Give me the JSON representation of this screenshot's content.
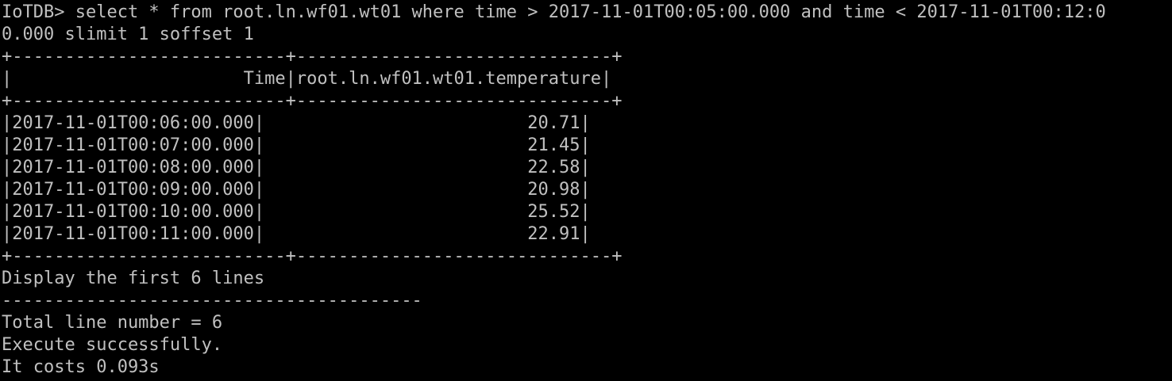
{
  "terminal": {
    "background": "#000000",
    "foreground": "#c0c0c0",
    "command_line_1": "IoTDB> select * from root.ln.wf01.wt01 where time > 2017-11-01T00:05:00.000 and time < 2017-11-01T00:12:0",
    "command_line_2": "0.000 slimit 1 soffset 1",
    "table": {
      "border_line": "+--------------------------+------------------------------+",
      "header": "|                      Time|root.ln.wf01.wt01.temperature|",
      "rows": [
        "|2017-11-01T00:06:00.000|                         20.71|",
        "|2017-11-01T00:07:00.000|                         21.45|",
        "|2017-11-01T00:08:00.000|                         22.58|",
        "|2017-11-01T00:09:00.000|                         20.98|",
        "|2017-11-01T00:10:00.000|                         25.52|",
        "|2017-11-01T00:11:00.000|                         22.91|"
      ]
    },
    "display_message": "Display the first 6 lines",
    "separator": "----------------------------------------",
    "total_lines": "Total line number = 6",
    "status": "Execute successfully.",
    "cost": "It costs 0.093s"
  }
}
